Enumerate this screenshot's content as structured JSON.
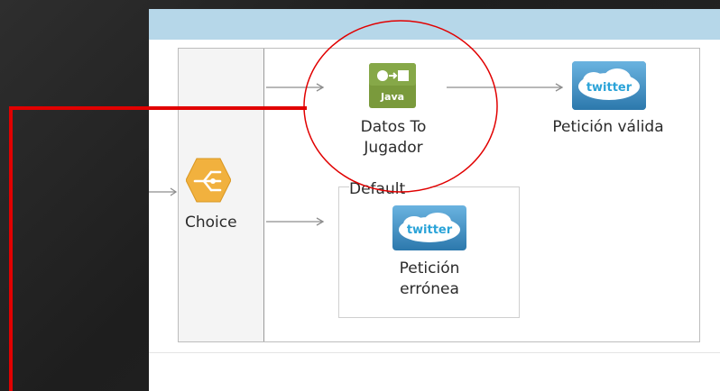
{
  "flow": {
    "choice": {
      "label": "Choice",
      "icon": "choice-router-icon",
      "color": "#f1b13e"
    },
    "java_step": {
      "badge": "Java",
      "label_line1": "Datos To",
      "label_line2": "Jugador",
      "icon": "java-transformer-icon",
      "color": "#7a9a3c"
    },
    "valid_step": {
      "badge": "twitter",
      "label": "Petición válida",
      "icon": "twitter-icon"
    },
    "default_route": {
      "label": "Default"
    },
    "error_step": {
      "badge": "twitter",
      "label_line1": "Petición",
      "label_line2": "errónea",
      "icon": "twitter-icon"
    }
  },
  "colors": {
    "header_bar": "#b6d7e9",
    "highlight_red": "#e10000",
    "twitter_blue": "#2aa3d8"
  }
}
